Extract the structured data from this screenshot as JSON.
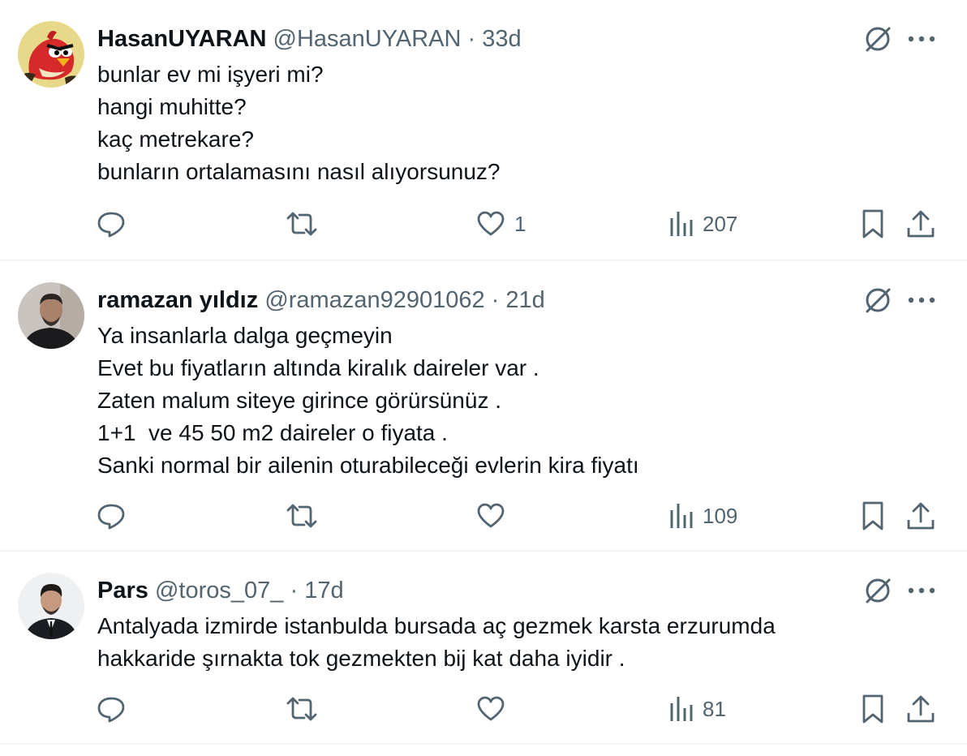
{
  "tweets": [
    {
      "name": "HasanUYARAN",
      "handle": "@HasanUYARAN",
      "separator": "·",
      "time": "33d",
      "lines": [
        "bunlar ev mi işyeri mi?",
        "hangi muhitte?",
        "kaç metrekare?",
        "bunların ortalamasını nasıl alıyorsunuz?"
      ],
      "likes": "1",
      "views": "207",
      "avatar": "angry-bird-avatar"
    },
    {
      "name": "ramazan yıldız",
      "handle": "@ramazan92901062",
      "separator": "·",
      "time": "21d",
      "lines": [
        "Ya insanlarla dalga geçmeyin",
        "Evet bu fiyatların altında kiralık daireler var .",
        "Zaten malum siteye girince görürsünüz .",
        "1+1  ve 45 50 m2 daireler o fiyata .",
        "Sanki normal bir ailenin oturabileceği evlerin kira fiyatı"
      ],
      "likes": "",
      "views": "109",
      "avatar": "man-photo-avatar"
    },
    {
      "name": "Pars",
      "handle": "@toros_07_",
      "separator": "·",
      "time": "17d",
      "lines": [
        "Antalyada izmirde istanbulda bursada aç gezmek karsta erzurumda",
        "hakkaride şırnakta tok gezmekten bij kat daha iyidir ."
      ],
      "likes": "",
      "views": "81",
      "avatar": "suit-man-avatar"
    }
  ],
  "icons": {
    "reply": "reply-icon",
    "repost": "repost-icon",
    "like": "heart-icon",
    "views": "views-chart-icon",
    "bookmark": "bookmark-icon",
    "share": "share-icon",
    "grok": "grok-icon",
    "more": "more-icon"
  },
  "colors": {
    "text": "#0f1419",
    "secondary": "#536471",
    "divider": "#eff3f4"
  }
}
